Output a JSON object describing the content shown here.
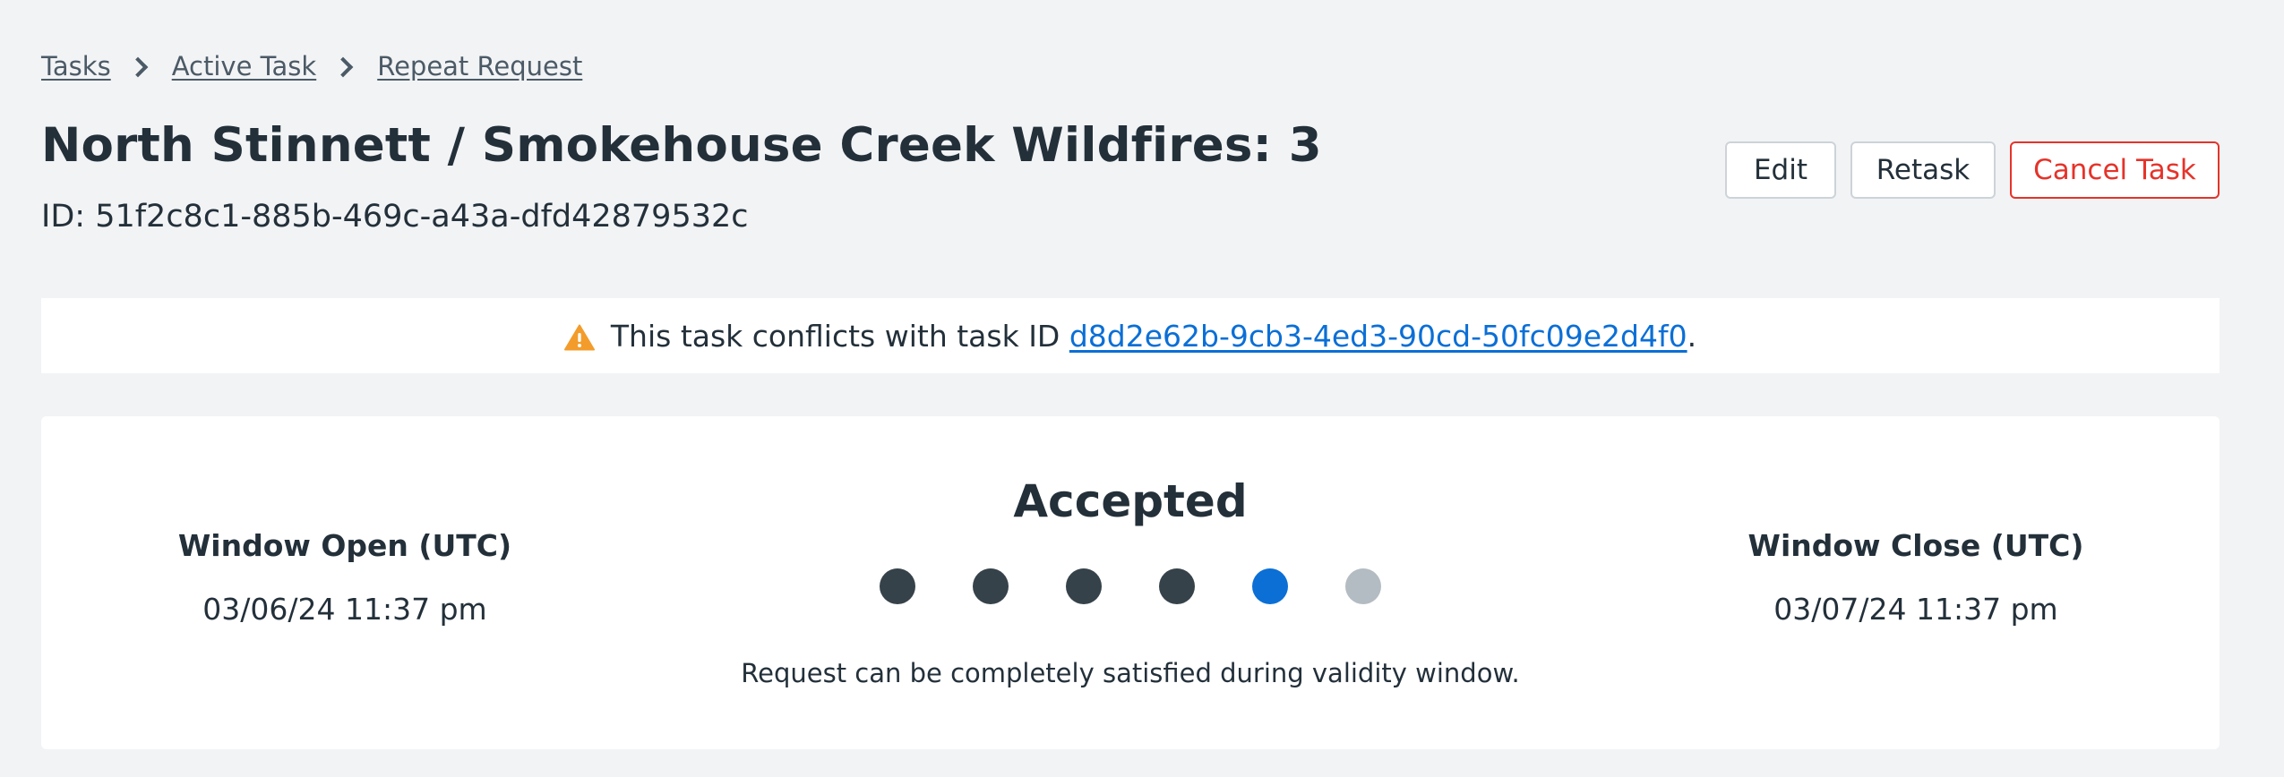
{
  "breadcrumb": {
    "items": [
      "Tasks",
      "Active Task",
      "Repeat Request"
    ]
  },
  "header": {
    "title": "North Stinnett / Smokehouse Creek Wildfires: 3",
    "id_label": "ID: 51f2c8c1-885b-469c-a43a-dfd42879532c"
  },
  "actions": {
    "edit_label": "Edit",
    "retask_label": "Retask",
    "cancel_label": "Cancel Task"
  },
  "alert": {
    "icon": "warning-icon",
    "text_before": "This task conflicts with task ID ",
    "link_text": "d8d2e62b-9cb3-4ed3-90cd-50fc09e2d4f0",
    "text_after": "."
  },
  "status": {
    "title": "Accepted",
    "description": "Request can be completely satisfied during validity window.",
    "steps": [
      "complete",
      "complete",
      "complete",
      "complete",
      "current",
      "pending"
    ],
    "window_open": {
      "label": "Window Open (UTC)",
      "value": "03/06/24 11:37 pm"
    },
    "window_close": {
      "label": "Window Close (UTC)",
      "value": "03/07/24 11:37 pm"
    }
  },
  "colors": {
    "accent": "#0b6fd6",
    "danger": "#e5332a",
    "warning": "#f39c2b",
    "step_complete": "#36424a",
    "step_pending": "#b3bcc2"
  }
}
